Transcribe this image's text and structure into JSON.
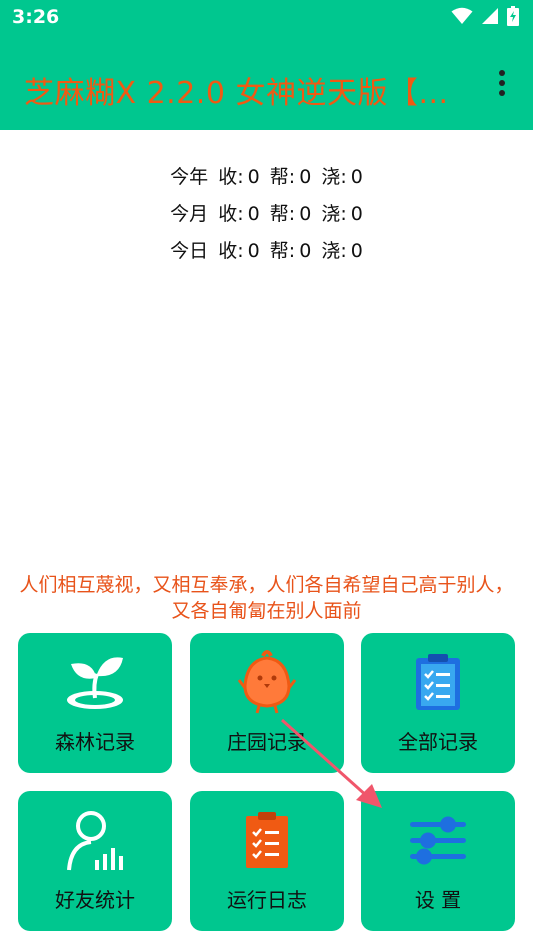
{
  "status_bar": {
    "time": "3:26"
  },
  "app_bar": {
    "title": "芝麻糊X 2.2.0 女神逆天版【..."
  },
  "stats": [
    {
      "period": "今年",
      "collect_label": "收:",
      "collect": "0",
      "help_label": "帮:",
      "help": "0",
      "water_label": "浇:",
      "water": "0"
    },
    {
      "period": "今月",
      "collect_label": "收:",
      "collect": "0",
      "help_label": "帮:",
      "help": "0",
      "water_label": "浇:",
      "water": "0"
    },
    {
      "period": "今日",
      "collect_label": "收:",
      "collect": "0",
      "help_label": "帮:",
      "help": "0",
      "water_label": "浇:",
      "water": "0"
    }
  ],
  "quote": "人们相互蔑视，又相互奉承，人们各自希望自己高于别人，又各自匍匐在别人面前",
  "tiles": [
    {
      "label": "森林记录",
      "icon": "sprout-icon"
    },
    {
      "label": "庄园记录",
      "icon": "chick-icon"
    },
    {
      "label": "全部记录",
      "icon": "checklist-clipboard-icon"
    },
    {
      "label": "好友统计",
      "icon": "user-stats-icon"
    },
    {
      "label": "运行日志",
      "icon": "log-clipboard-icon"
    },
    {
      "label": "设 置",
      "icon": "sliders-icon"
    }
  ],
  "colors": {
    "accent": "#00c78f",
    "title": "#f05a13",
    "quote": "#e8531a",
    "arrow": "#f0566b"
  }
}
